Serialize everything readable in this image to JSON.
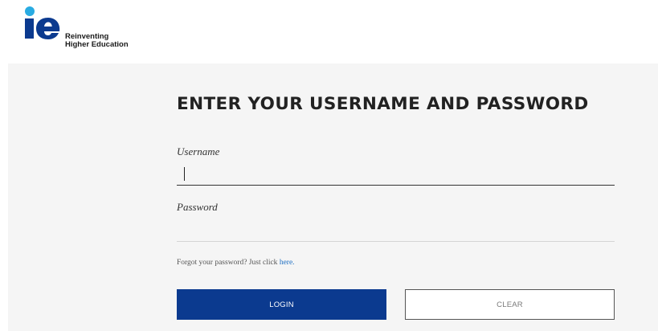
{
  "logo": {
    "mark": "ie",
    "tagline_line1": "Reinventing",
    "tagline_line2": "Higher Education",
    "colors": {
      "dot": "#29abe2",
      "mark": "#0b3a8f"
    }
  },
  "form": {
    "title": "ENTER YOUR USERNAME AND PASSWORD",
    "username_label": "Username",
    "username_value": "",
    "password_label": "Password",
    "password_value": "",
    "forgot_text": "Forgot your password? Just click ",
    "forgot_link": "here.",
    "login_label": "LOGIN",
    "clear_label": "CLEAR"
  },
  "colors": {
    "primary": "#0b3a8f",
    "link": "#1f6fc2",
    "panel_bg": "#f5f5f5"
  }
}
